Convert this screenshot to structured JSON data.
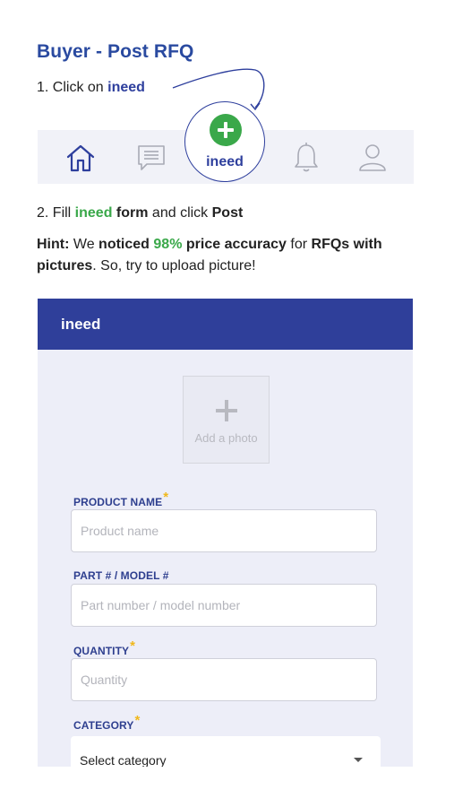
{
  "heading": "Buyer - Post RFQ",
  "step1": {
    "prefix": "1. Click on ",
    "keyword": "ineed"
  },
  "tabbar": {
    "items": [
      {
        "name": "Home",
        "icon": "home-icon"
      },
      {
        "name": "Messages",
        "icon": "message-icon"
      },
      {
        "name": "ineed",
        "icon": "plus-circle-icon",
        "label": "ineed"
      },
      {
        "name": "Notifications",
        "icon": "bell-icon"
      },
      {
        "name": "Profile",
        "icon": "user-icon"
      }
    ],
    "highlight_color": "#3aa84a"
  },
  "step2": {
    "prefix": "2. Fill ",
    "keyword": "ineed",
    "middle": "form",
    "suffix": " and click ",
    "action": "Post"
  },
  "hint": {
    "label": "Hint:",
    "t1": " We ",
    "t2": "noticed",
    "t3": " ",
    "percent": "98%",
    "t4": " ",
    "t5": "price accuracy",
    "t6": " for ",
    "t7": "RFQs with pictures",
    "t8": ". So, try to upload picture!"
  },
  "form": {
    "title": "ineed",
    "photo": {
      "label": "Add a photo"
    },
    "fields": [
      {
        "label": "PRODUCT NAME",
        "required": true,
        "placeholder": "Product name",
        "value": ""
      },
      {
        "label": "PART # / MODEL #",
        "required": false,
        "placeholder": "Part number / model number",
        "value": ""
      },
      {
        "label": "QUANTITY",
        "required": true,
        "placeholder": "Quantity",
        "value": ""
      }
    ],
    "category": {
      "label": "CATEGORY",
      "required": true,
      "selected": "Select category"
    },
    "required_mark": "*"
  },
  "colors": {
    "brand": "#2f3f9a",
    "accent_green": "#3aa84a",
    "required_star": "#f0b81c"
  }
}
